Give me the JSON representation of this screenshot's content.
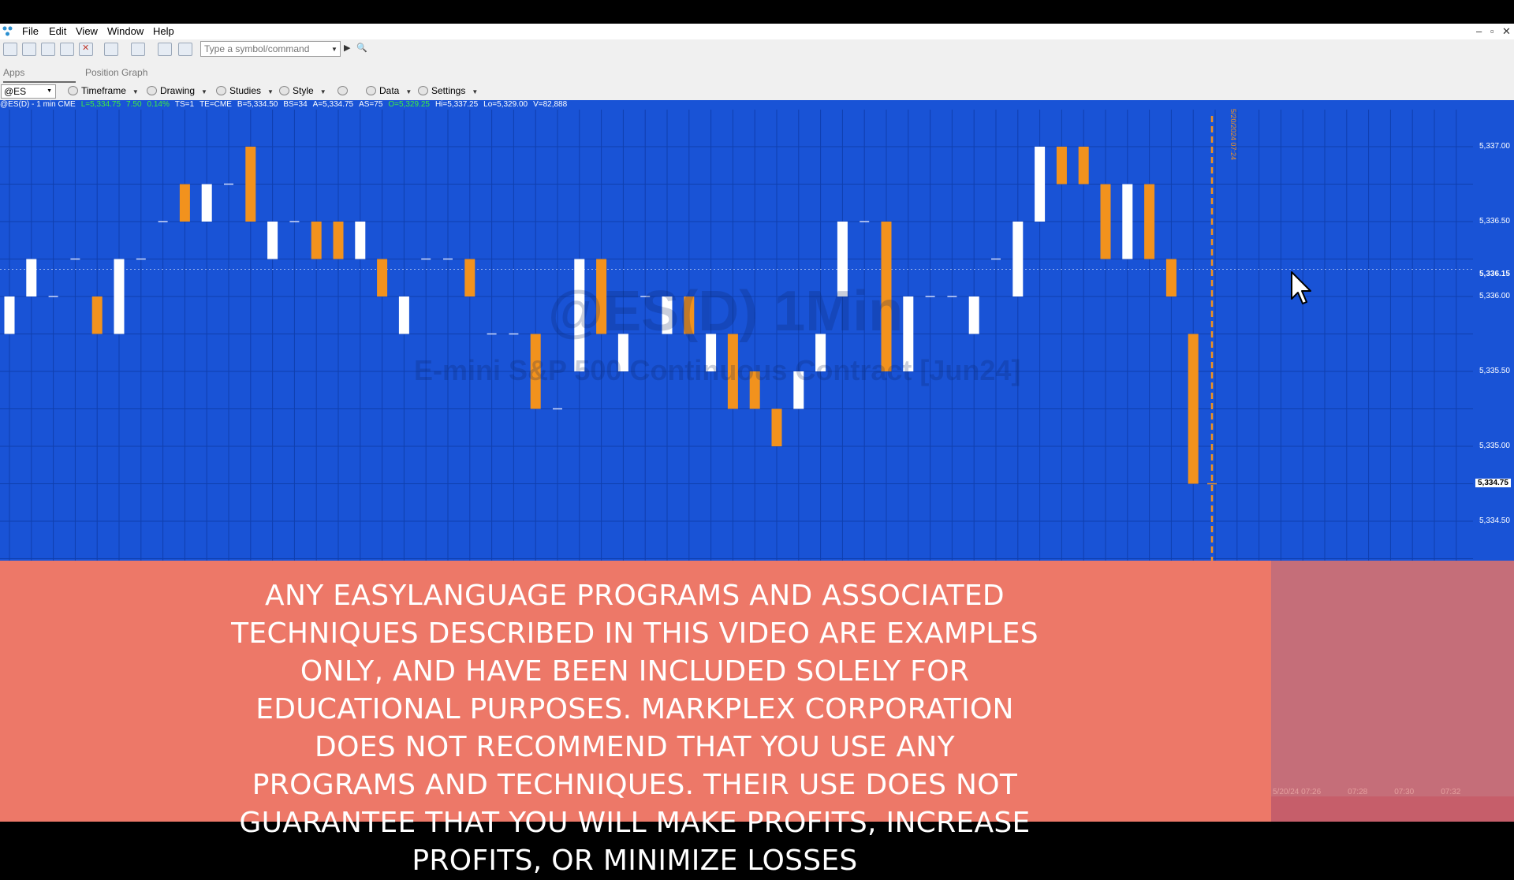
{
  "menubar": {
    "items": [
      "File",
      "Edit",
      "View",
      "Window",
      "Help"
    ],
    "window_controls": [
      "–",
      "▫",
      "✕"
    ]
  },
  "toolbar": {
    "command_placeholder": "Type a symbol/command"
  },
  "workspace_tabs": {
    "apps_label": "Apps",
    "active_tab": "Position Graph"
  },
  "chart_toolbar": {
    "symbol": "@ES",
    "buttons": [
      "Timeframe",
      "Drawing",
      "Studies",
      "Style",
      "Data",
      "Settings"
    ]
  },
  "status_line": {
    "symbol_info": "@ES(D) - 1 min  CME",
    "last": "L=5,334.75",
    "change": "7.50",
    "change_pct": "0.14%",
    "ts": "TS=1",
    "te": "TE=CME",
    "bid": "B=5,334.50",
    "bid_size": "BS=34",
    "ask": "A=5,334.75",
    "ask_size": "AS=75",
    "open": "O=5,329.25",
    "high": "Hi=5,337.25",
    "low": "Lo=5,329.00",
    "volume": "V=82,888"
  },
  "colors": {
    "chart_bg": "#1953d6",
    "up_bar": "#ffffff",
    "down_bar": "#f2921d",
    "status_green": "#3ff03f",
    "disclaimer_bg": "#ed7868"
  },
  "chart_data": {
    "type": "bar",
    "title": "@ES(D) 1Min",
    "subtitle": "E-mini S&P 500 Continuous Contract [Jun24]",
    "ylim": [
      5334.25,
      5337.25
    ],
    "y_ticks": [
      "5,337.00",
      "5,336.50",
      "5,336.00",
      "5,335.50",
      "5,335.00",
      "5,334.50"
    ],
    "current_price_tag": "5,336.15",
    "last_price_tag": "5,334.75",
    "time_marker_label": "5/20/2024 07:24",
    "bars": [
      {
        "open": 5335.75,
        "close": 5336.0,
        "high": 5336.0,
        "low": 5335.75
      },
      {
        "open": 5336.0,
        "close": 5336.25,
        "high": 5336.25,
        "low": 5336.0
      },
      {
        "open": 5336.0,
        "close": 5336.0,
        "high": 5336.0,
        "low": 5336.0
      },
      {
        "open": 5336.25,
        "close": 5336.25,
        "high": 5336.25,
        "low": 5336.25
      },
      {
        "open": 5336.0,
        "close": 5335.75,
        "high": 5336.0,
        "low": 5335.75
      },
      {
        "open": 5335.75,
        "close": 5336.25,
        "high": 5336.25,
        "low": 5335.75
      },
      {
        "open": 5336.25,
        "close": 5336.25,
        "high": 5336.25,
        "low": 5336.25
      },
      {
        "open": 5336.5,
        "close": 5336.5,
        "high": 5336.5,
        "low": 5336.5
      },
      {
        "open": 5336.75,
        "close": 5336.5,
        "high": 5336.75,
        "low": 5336.5
      },
      {
        "open": 5336.5,
        "close": 5336.75,
        "high": 5336.75,
        "low": 5336.5
      },
      {
        "open": 5336.75,
        "close": 5336.75,
        "high": 5336.75,
        "low": 5336.75
      },
      {
        "open": 5337.0,
        "close": 5336.5,
        "high": 5337.0,
        "low": 5336.5
      },
      {
        "open": 5336.25,
        "close": 5336.5,
        "high": 5336.5,
        "low": 5336.25
      },
      {
        "open": 5336.5,
        "close": 5336.5,
        "high": 5336.5,
        "low": 5336.5
      },
      {
        "open": 5336.5,
        "close": 5336.25,
        "high": 5336.5,
        "low": 5336.25
      },
      {
        "open": 5336.5,
        "close": 5336.25,
        "high": 5336.5,
        "low": 5336.25
      },
      {
        "open": 5336.25,
        "close": 5336.5,
        "high": 5336.5,
        "low": 5336.25
      },
      {
        "open": 5336.25,
        "close": 5336.0,
        "high": 5336.25,
        "low": 5336.0
      },
      {
        "open": 5335.75,
        "close": 5336.0,
        "high": 5336.0,
        "low": 5335.75
      },
      {
        "open": 5336.25,
        "close": 5336.25,
        "high": 5336.25,
        "low": 5336.25
      },
      {
        "open": 5336.25,
        "close": 5336.25,
        "high": 5336.25,
        "low": 5336.25
      },
      {
        "open": 5336.25,
        "close": 5336.0,
        "high": 5336.25,
        "low": 5336.0
      },
      {
        "open": 5335.75,
        "close": 5335.75,
        "high": 5335.75,
        "low": 5335.75
      },
      {
        "open": 5335.75,
        "close": 5335.75,
        "high": 5335.75,
        "low": 5335.75
      },
      {
        "open": 5335.75,
        "close": 5335.25,
        "high": 5335.75,
        "low": 5335.25
      },
      {
        "open": 5335.25,
        "close": 5335.25,
        "high": 5335.25,
        "low": 5335.25
      },
      {
        "open": 5335.5,
        "close": 5336.25,
        "high": 5336.25,
        "low": 5335.5
      },
      {
        "open": 5336.25,
        "close": 5335.75,
        "high": 5336.25,
        "low": 5335.75
      },
      {
        "open": 5335.5,
        "close": 5335.75,
        "high": 5335.75,
        "low": 5335.5
      },
      {
        "open": 5336.0,
        "close": 5336.0,
        "high": 5336.0,
        "low": 5336.0
      },
      {
        "open": 5335.75,
        "close": 5336.0,
        "high": 5336.0,
        "low": 5335.75
      },
      {
        "open": 5336.0,
        "close": 5335.75,
        "high": 5336.0,
        "low": 5335.75
      },
      {
        "open": 5335.5,
        "close": 5335.75,
        "high": 5335.75,
        "low": 5335.5
      },
      {
        "open": 5335.75,
        "close": 5335.25,
        "high": 5335.75,
        "low": 5335.25
      },
      {
        "open": 5335.5,
        "close": 5335.25,
        "high": 5335.5,
        "low": 5335.25
      },
      {
        "open": 5335.25,
        "close": 5335.0,
        "high": 5335.25,
        "low": 5335.0
      },
      {
        "open": 5335.25,
        "close": 5335.5,
        "high": 5335.5,
        "low": 5335.25
      },
      {
        "open": 5335.5,
        "close": 5335.75,
        "high": 5335.75,
        "low": 5335.5
      },
      {
        "open": 5336.0,
        "close": 5336.5,
        "high": 5336.5,
        "low": 5336.0
      },
      {
        "open": 5336.5,
        "close": 5336.5,
        "high": 5336.5,
        "low": 5336.5
      },
      {
        "open": 5336.5,
        "close": 5335.5,
        "high": 5336.5,
        "low": 5335.5
      },
      {
        "open": 5335.5,
        "close": 5336.0,
        "high": 5336.0,
        "low": 5335.5
      },
      {
        "open": 5336.0,
        "close": 5336.0,
        "high": 5336.0,
        "low": 5336.0
      },
      {
        "open": 5336.0,
        "close": 5336.0,
        "high": 5336.0,
        "low": 5336.0
      },
      {
        "open": 5335.75,
        "close": 5336.0,
        "high": 5336.0,
        "low": 5335.75
      },
      {
        "open": 5336.25,
        "close": 5336.25,
        "high": 5336.25,
        "low": 5336.25
      },
      {
        "open": 5336.0,
        "close": 5336.5,
        "high": 5336.5,
        "low": 5336.0
      },
      {
        "open": 5336.5,
        "close": 5337.0,
        "high": 5337.0,
        "low": 5336.5
      },
      {
        "open": 5337.0,
        "close": 5336.75,
        "high": 5337.0,
        "low": 5336.75
      },
      {
        "open": 5337.0,
        "close": 5336.75,
        "high": 5337.0,
        "low": 5336.75
      },
      {
        "open": 5336.75,
        "close": 5336.25,
        "high": 5336.75,
        "low": 5336.25
      },
      {
        "open": 5336.25,
        "close": 5336.75,
        "high": 5336.75,
        "low": 5336.25
      },
      {
        "open": 5336.75,
        "close": 5336.25,
        "high": 5336.75,
        "low": 5336.25
      },
      {
        "open": 5336.25,
        "close": 5336.0,
        "high": 5336.25,
        "low": 5336.0
      },
      {
        "open": 5335.75,
        "close": 5334.75,
        "high": 5335.75,
        "low": 5334.75
      }
    ]
  },
  "disclaimer": {
    "text": "ANY EASYLANGUAGE PROGRAMS AND ASSOCIATED TECHNIQUES DESCRIBED IN THIS VIDEO ARE EXAMPLES ONLY, AND HAVE BEEN INCLUDED SOLELY FOR EDUCATIONAL PURPOSES. MARKPLEX CORPORATION DOES NOT RECOMMEND THAT YOU USE ANY PROGRAMS AND TECHNIQUES. THEIR USE DOES NOT GUARANTEE THAT YOU WILL MAKE PROFITS, INCREASE PROFITS, OR MINIMIZE LOSSES"
  },
  "time_axis": {
    "labels": [
      "5/20/24 07:26",
      "07:28",
      "07:30",
      "07:32"
    ]
  }
}
